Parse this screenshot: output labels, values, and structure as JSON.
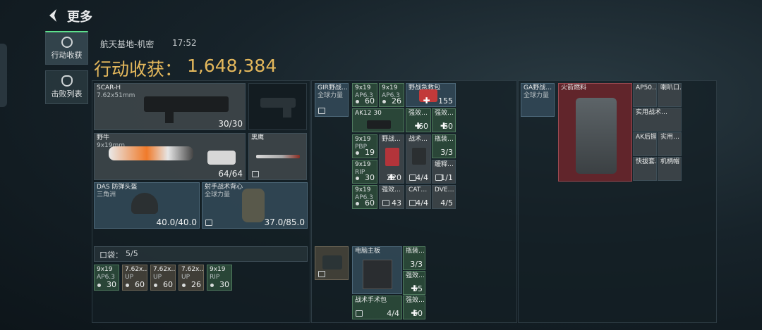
{
  "header": {
    "title": "更多"
  },
  "tabs": [
    {
      "label": "行动收获",
      "icon": "target-icon"
    },
    {
      "label": "击败列表",
      "icon": "skull-icon"
    }
  ],
  "session": {
    "map": "航天基地-机密",
    "time": "17:52"
  },
  "yield": {
    "label": "行动收获：",
    "value": "1,648,384"
  },
  "equipment": {
    "primary": {
      "name": "SCAR-H",
      "caliber": "7.62x51mm",
      "ammo": "30/30"
    },
    "secondary": {
      "name": "野牛",
      "caliber": "9x19mm",
      "ammo": "64/64"
    },
    "melee": {
      "name": "黑鹰"
    },
    "helmet": {
      "name": "DAS 防弹头盔",
      "sub": "三角洲",
      "durability": "40.0/40.0"
    },
    "vest": {
      "name": "射手战术背心",
      "sub": "全球力量",
      "durability": "37.0/85.0"
    }
  },
  "pockets": {
    "label": "口袋：",
    "capacity": "5/5",
    "items": [
      {
        "name": "9x19",
        "sub": "AP6.3",
        "count": "30"
      },
      {
        "name": "7.62x…",
        "sub": "UP",
        "count": "60"
      },
      {
        "name": "7.62x…",
        "sub": "UP",
        "count": "60"
      },
      {
        "name": "7.62x…",
        "sub": "UP",
        "count": "26"
      },
      {
        "name": "9x19",
        "sub": "RIP",
        "count": "30"
      }
    ]
  },
  "chest_rig": {
    "name": "GIR野战…",
    "sub": "全球力量",
    "items": [
      {
        "name": "9x19",
        "sub": "AP6.3",
        "count": "60"
      },
      {
        "name": "9x19",
        "sub": "AP6.3",
        "count": "26"
      },
      {
        "name": "野战急救包",
        "count": "155"
      },
      {
        "name": "AK12 30",
        "count": ""
      },
      {
        "name": "强效…",
        "count": "60"
      },
      {
        "name": "强效…",
        "count": "60"
      },
      {
        "name": "9x19",
        "sub": "PBP",
        "count": "19"
      },
      {
        "name": "野战…",
        "count": "220"
      },
      {
        "name": "战术…",
        "count": "4/4"
      },
      {
        "name": "瓶装…",
        "count": "3/3"
      },
      {
        "name": "9x19",
        "sub": "RIP",
        "count": "30"
      },
      {
        "name": "缓释…",
        "count": "1/1"
      },
      {
        "name": "9x19",
        "sub": "AP6.3",
        "count": "60"
      },
      {
        "name": "强效…",
        "count": "43"
      },
      {
        "name": "CAT…",
        "count": "4/4"
      },
      {
        "name": "DVE…",
        "count": "4/5"
      }
    ]
  },
  "backpack": {
    "items": [
      {
        "name": "电脑主板",
        "count": ""
      },
      {
        "name": "瓶装…",
        "count": "3/3"
      },
      {
        "name": "强效…",
        "count": "55"
      },
      {
        "name": "战术手术包",
        "count": "4/4"
      },
      {
        "name": "强效…",
        "count": "60"
      }
    ]
  },
  "safebox": {
    "name": "GA野战…",
    "sub": "全球力量",
    "rocket_fuel": "火箭燃料",
    "items": [
      {
        "name": "AP50…"
      },
      {
        "name": "喇叭口…"
      },
      {
        "name": "实用战术…"
      },
      {
        "name": "AK后握"
      },
      {
        "name": "实用…"
      },
      {
        "name": "快拔套…"
      },
      {
        "name": "机柄帽"
      }
    ]
  }
}
